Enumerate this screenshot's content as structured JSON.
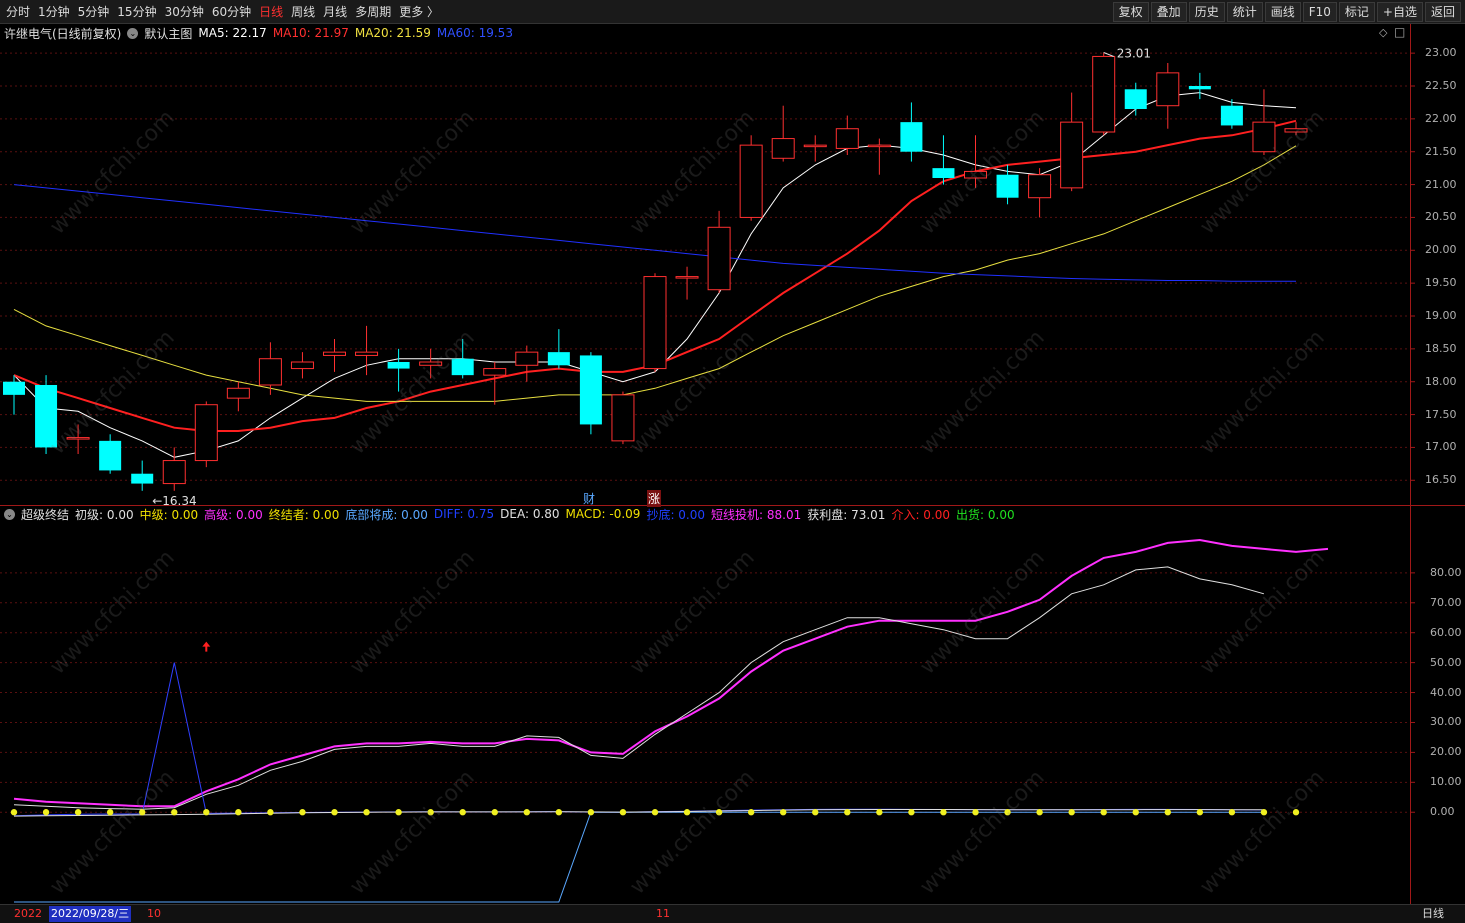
{
  "toolbar": {
    "periods": [
      "分时",
      "1分钟",
      "5分钟",
      "15分钟",
      "30分钟",
      "60分钟",
      "日线",
      "周线",
      "月线",
      "多周期",
      "更多 〉"
    ],
    "active_period": "日线",
    "buttons": [
      "复权",
      "叠加",
      "历史",
      "统计",
      "画线",
      "F10",
      "标记",
      "+自选",
      "返回"
    ]
  },
  "main_legend": {
    "stock": "许继电气(日线前复权)",
    "template": "默认主图",
    "ma5_label": "MA5: 22.17",
    "ma10_label": "MA10: 21.97",
    "ma20_label": "MA20: 21.59",
    "ma60_label": "MA60: 19.53",
    "colors": {
      "ma5": "#ffffff",
      "ma10": "#ff2020",
      "ma20": "#e8e040",
      "ma60": "#2030ff"
    }
  },
  "main_yaxis": [
    "23.00",
    "22.50",
    "22.00",
    "21.50",
    "21.00",
    "20.50",
    "20.00",
    "19.50",
    "19.00",
    "18.50",
    "18.00",
    "17.50",
    "17.00",
    "16.50"
  ],
  "main_annotations": {
    "high": "23.01",
    "low": "←16.34",
    "caiwu": "财",
    "zhang": "涨"
  },
  "indicator_legend": {
    "name": "超级终结",
    "items": [
      {
        "text": "初级: 0.00",
        "color": "#e0e0e0"
      },
      {
        "text": "中级: 0.00",
        "color": "#f0e000"
      },
      {
        "text": "高级: 0.00",
        "color": "#ff30ff"
      },
      {
        "text": "终结者: 0.00",
        "color": "#f0e000"
      },
      {
        "text": "底部将成: 0.00",
        "color": "#5aa8ff"
      },
      {
        "text": "DIFF: 0.75",
        "color": "#2040ff"
      },
      {
        "text": "DEA: 0.80",
        "color": "#e0e0e0"
      },
      {
        "text": "MACD: -0.09",
        "color": "#f0e000"
      },
      {
        "text": "抄底: 0.00",
        "color": "#2040ff"
      },
      {
        "text": "短线投机: 88.01",
        "color": "#ff30ff"
      },
      {
        "text": "获利盘: 73.01",
        "color": "#e0e0e0"
      },
      {
        "text": "介入: 0.00",
        "color": "#ff2020"
      },
      {
        "text": "出货: 0.00",
        "color": "#20e020"
      }
    ]
  },
  "indicator_yaxis": [
    "80.00",
    "70.00",
    "60.00",
    "50.00",
    "40.00",
    "30.00",
    "20.00",
    "10.00",
    "0.00"
  ],
  "bottom_bar": {
    "year": "2022",
    "date": "2022/09/28/三",
    "m10": "10",
    "m11": "11",
    "period": "日线"
  },
  "watermark": "www.cfchi.com",
  "chart_data": [
    {
      "type": "candlestick",
      "title": "许继电气(日线前复权)",
      "ylim": [
        16.2,
        23.2
      ],
      "candles": [
        {
          "o": 18.0,
          "c": 17.8,
          "h": 18.1,
          "l": 17.5
        },
        {
          "o": 17.95,
          "c": 17.0,
          "h": 18.1,
          "l": 16.9
        },
        {
          "o": 17.15,
          "c": 17.15,
          "h": 17.35,
          "l": 16.9
        },
        {
          "o": 17.1,
          "c": 16.65,
          "h": 17.2,
          "l": 16.6
        },
        {
          "o": 16.6,
          "c": 16.45,
          "h": 16.8,
          "l": 16.34
        },
        {
          "o": 16.45,
          "c": 16.8,
          "h": 17.0,
          "l": 16.34
        },
        {
          "o": 16.8,
          "c": 17.65,
          "h": 17.7,
          "l": 16.7
        },
        {
          "o": 17.75,
          "c": 17.9,
          "h": 18.0,
          "l": 17.55
        },
        {
          "o": 17.95,
          "c": 18.35,
          "h": 18.6,
          "l": 17.8
        },
        {
          "o": 18.2,
          "c": 18.3,
          "h": 18.45,
          "l": 18.05
        },
        {
          "o": 18.4,
          "c": 18.45,
          "h": 18.65,
          "l": 18.15
        },
        {
          "o": 18.4,
          "c": 18.45,
          "h": 18.85,
          "l": 18.1
        },
        {
          "o": 18.3,
          "c": 18.2,
          "h": 18.5,
          "l": 17.85
        },
        {
          "o": 18.25,
          "c": 18.3,
          "h": 18.5,
          "l": 18.05
        },
        {
          "o": 18.35,
          "c": 18.1,
          "h": 18.65,
          "l": 18.05
        },
        {
          "o": 18.1,
          "c": 18.2,
          "h": 18.3,
          "l": 17.65
        },
        {
          "o": 18.25,
          "c": 18.45,
          "h": 18.55,
          "l": 18.0
        },
        {
          "o": 18.45,
          "c": 18.25,
          "h": 18.8,
          "l": 18.2
        },
        {
          "o": 18.4,
          "c": 17.35,
          "h": 18.45,
          "l": 17.2
        },
        {
          "o": 17.1,
          "c": 17.8,
          "h": 17.85,
          "l": 17.05
        },
        {
          "o": 18.2,
          "c": 19.6,
          "h": 19.65,
          "l": 18.15
        },
        {
          "o": 19.6,
          "c": 19.6,
          "h": 19.75,
          "l": 19.25
        },
        {
          "o": 19.4,
          "c": 20.35,
          "h": 20.6,
          "l": 19.35
        },
        {
          "o": 20.5,
          "c": 21.6,
          "h": 21.75,
          "l": 20.45
        },
        {
          "o": 21.4,
          "c": 21.7,
          "h": 22.2,
          "l": 21.35
        },
        {
          "o": 21.6,
          "c": 21.6,
          "h": 21.75,
          "l": 21.35
        },
        {
          "o": 21.55,
          "c": 21.85,
          "h": 22.05,
          "l": 21.45
        },
        {
          "o": 21.6,
          "c": 21.6,
          "h": 21.7,
          "l": 21.15
        },
        {
          "o": 21.95,
          "c": 21.5,
          "h": 22.25,
          "l": 21.35
        },
        {
          "o": 21.25,
          "c": 21.1,
          "h": 21.75,
          "l": 21.0
        },
        {
          "o": 21.1,
          "c": 21.2,
          "h": 21.75,
          "l": 20.95
        },
        {
          "o": 21.15,
          "c": 20.8,
          "h": 21.3,
          "l": 20.7
        },
        {
          "o": 20.8,
          "c": 21.15,
          "h": 21.25,
          "l": 20.5
        },
        {
          "o": 20.95,
          "c": 21.95,
          "h": 22.4,
          "l": 20.9
        },
        {
          "o": 21.8,
          "c": 22.95,
          "h": 23.01,
          "l": 21.75
        },
        {
          "o": 22.45,
          "c": 22.15,
          "h": 22.55,
          "l": 22.05
        },
        {
          "o": 22.2,
          "c": 22.7,
          "h": 22.85,
          "l": 21.85
        },
        {
          "o": 22.5,
          "c": 22.45,
          "h": 22.7,
          "l": 22.3
        },
        {
          "o": 22.2,
          "c": 21.9,
          "h": 22.3,
          "l": 21.85
        },
        {
          "o": 21.5,
          "c": 21.95,
          "h": 22.45,
          "l": 21.45
        },
        {
          "o": 21.8,
          "c": 21.85,
          "h": 21.95,
          "l": 21.75
        }
      ],
      "series": [
        {
          "name": "MA5",
          "values": [
            18.1,
            17.6,
            17.55,
            17.3,
            17.1,
            16.85,
            16.95,
            17.1,
            17.45,
            17.75,
            18.05,
            18.25,
            18.35,
            18.35,
            18.35,
            18.3,
            18.3,
            18.3,
            18.15,
            18.0,
            18.15,
            18.65,
            19.35,
            20.25,
            20.95,
            21.3,
            21.55,
            21.6,
            21.55,
            21.45,
            21.3,
            21.2,
            21.15,
            21.35,
            21.75,
            22.15,
            22.35,
            22.4,
            22.25,
            22.2,
            22.17
          ]
        },
        {
          "name": "MA10",
          "values": [
            18.1,
            17.9,
            17.75,
            17.6,
            17.45,
            17.3,
            17.25,
            17.25,
            17.3,
            17.4,
            17.45,
            17.6,
            17.7,
            17.85,
            17.95,
            18.05,
            18.15,
            18.2,
            18.15,
            18.15,
            18.25,
            18.45,
            18.65,
            19.0,
            19.35,
            19.65,
            19.95,
            20.3,
            20.75,
            21.05,
            21.2,
            21.3,
            21.35,
            21.4,
            21.45,
            21.5,
            21.6,
            21.7,
            21.75,
            21.85,
            21.97
          ]
        },
        {
          "name": "MA20",
          "values": [
            19.1,
            18.85,
            18.7,
            18.55,
            18.4,
            18.25,
            18.1,
            18.0,
            17.9,
            17.8,
            17.75,
            17.7,
            17.7,
            17.7,
            17.7,
            17.7,
            17.75,
            17.8,
            17.8,
            17.8,
            17.9,
            18.05,
            18.2,
            18.45,
            18.7,
            18.9,
            19.1,
            19.3,
            19.45,
            19.6,
            19.7,
            19.85,
            19.95,
            20.1,
            20.25,
            20.45,
            20.65,
            20.85,
            21.05,
            21.3,
            21.59
          ]
        },
        {
          "name": "MA60",
          "values": [
            21.0,
            20.95,
            20.9,
            20.85,
            20.8,
            20.75,
            20.7,
            20.65,
            20.6,
            20.55,
            20.5,
            20.45,
            20.4,
            20.35,
            20.3,
            20.25,
            20.2,
            20.15,
            20.1,
            20.05,
            20.0,
            19.95,
            19.9,
            19.85,
            19.8,
            19.77,
            19.74,
            19.71,
            19.68,
            19.65,
            19.63,
            19.61,
            19.59,
            19.57,
            19.56,
            19.55,
            19.54,
            19.54,
            19.53,
            19.53,
            19.53
          ]
        }
      ]
    },
    {
      "type": "line",
      "title": "超级终结",
      "ylim": [
        -30,
        97
      ],
      "series": [
        {
          "name": "短线投机",
          "values": [
            4.5,
            3.5,
            3.0,
            2.5,
            2.0,
            2.0,
            7,
            11,
            16,
            19,
            22,
            23,
            23,
            23.5,
            23,
            23,
            24.5,
            24,
            20,
            19.5,
            27,
            32,
            38,
            47,
            54,
            58,
            62,
            64,
            64,
            64,
            64,
            67,
            71,
            79,
            85,
            87,
            90,
            91,
            89,
            88,
            87,
            88.01
          ]
        },
        {
          "name": "获利盘",
          "values": [
            2.5,
            2.0,
            1.5,
            1.2,
            1.0,
            1.5,
            6,
            9,
            14,
            17,
            21,
            22,
            22,
            23,
            22,
            22,
            25.5,
            25,
            19,
            18,
            26,
            33,
            40,
            50,
            57,
            61,
            65,
            65,
            63,
            61,
            58,
            58,
            65,
            73,
            76,
            81,
            82,
            78,
            76,
            73.01
          ]
        },
        {
          "name": "DIFF",
          "values": [
            -1.2,
            -0.9,
            -0.7,
            -0.6,
            -0.55,
            50,
            -0.4,
            -0.3,
            -0.2,
            -0.1,
            0.0,
            0.05,
            0.1,
            0.15,
            0.1,
            0.1,
            0.15,
            0.2,
            0.05,
            0.0,
            0.2,
            0.35,
            0.5,
            0.7,
            0.85,
            0.95,
            1.0,
            1.0,
            0.95,
            0.9,
            0.85,
            0.8,
            0.8,
            0.85,
            0.9,
            0.95,
            0.95,
            0.9,
            0.85,
            0.75
          ]
        },
        {
          "name": "底部将成",
          "values": [
            -30,
            -30,
            -30,
            -30,
            -30,
            -30,
            -30,
            -30,
            -30,
            -30,
            -30,
            -30,
            -30,
            -30,
            -30,
            -30,
            -30,
            -30,
            0,
            0,
            0,
            0,
            0,
            0,
            0,
            0,
            0,
            0,
            0,
            0,
            0,
            0,
            0,
            0,
            0,
            0,
            0,
            0,
            0,
            0
          ]
        },
        {
          "name": "DEA",
          "values": [
            -1.3,
            -1.2,
            -1.1,
            -1.0,
            -0.9,
            -0.8,
            -0.65,
            -0.5,
            -0.35,
            -0.2,
            -0.1,
            0.0,
            0.05,
            0.1,
            0.1,
            0.1,
            0.12,
            0.15,
            0.1,
            0.05,
            0.12,
            0.25,
            0.4,
            0.55,
            0.7,
            0.8,
            0.88,
            0.92,
            0.92,
            0.9,
            0.87,
            0.84,
            0.82,
            0.82,
            0.84,
            0.86,
            0.88,
            0.87,
            0.84,
            0.8
          ]
        }
      ]
    }
  ]
}
